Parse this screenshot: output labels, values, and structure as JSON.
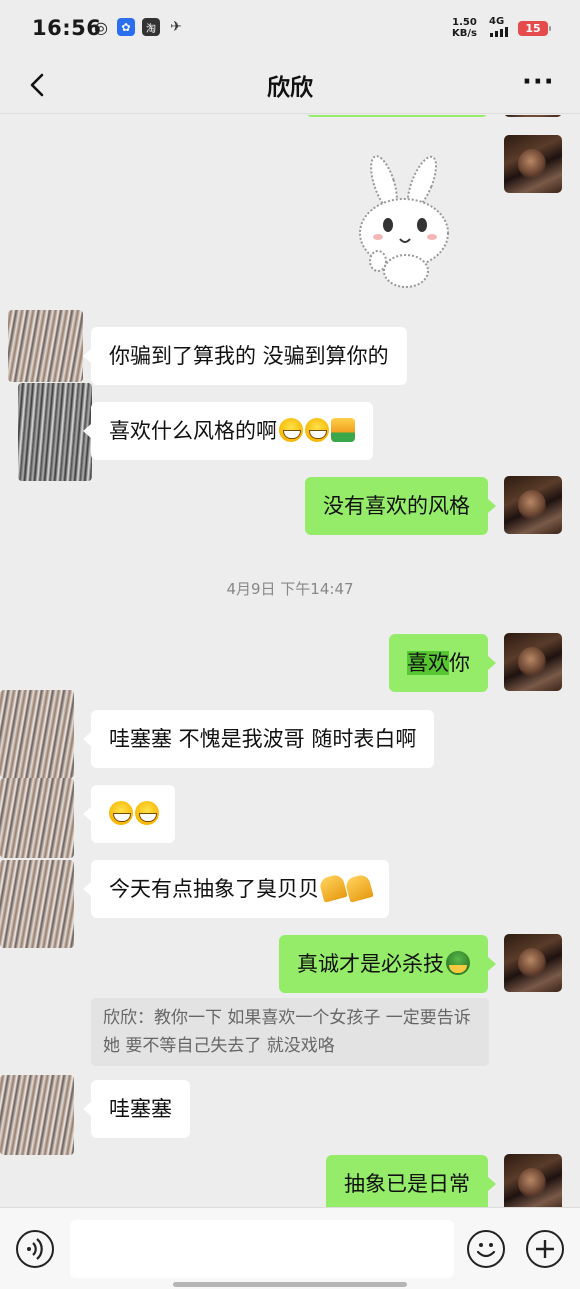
{
  "status_bar": {
    "time": "16:56",
    "net_speed_value": "1.50",
    "net_speed_unit": "KB/s",
    "network": "4G",
    "battery": "15",
    "app_icons": [
      "weibo-icon",
      "baidu-icon",
      "taobao-icon",
      "bird-icon"
    ],
    "taobao_label": "淘",
    "battery_color": "#e64b4b"
  },
  "nav": {
    "title": "欣欣",
    "more": "···"
  },
  "colors": {
    "out_bubble": "#95ec69",
    "in_bubble": "#ffffff",
    "background": "#ededed",
    "highlight": "#58c632"
  },
  "messages": {
    "m1": "你骗到了算我的 没骗到算你的",
    "m2": "喜欢什么风格的啊",
    "m3": "没有喜欢的风格",
    "timestamp": "4月9日 下午14:47",
    "m4_highlight": "喜欢",
    "m4_rest": "你",
    "m5": "哇塞塞 不愧是我波哥 随时表白啊",
    "m7": "今天有点抽象了臭贝贝",
    "m8": "真诚才是必杀技",
    "quote": "欣欣：教你一下 如果喜欢一个女孩子 一定要告诉她 要不等自己失去了 就没戏咯",
    "m9": "哇塞塞",
    "m10": "抽象已是日常"
  },
  "emojis": {
    "m2": [
      "grin-emoji",
      "grin-emoji",
      "thumbs-up-emoji"
    ],
    "m6": [
      "grin-emoji",
      "grin-emoji"
    ],
    "m7": [
      "clap-emoji",
      "clap-emoji"
    ],
    "m8": [
      "turtle-emoji"
    ]
  },
  "sticker": "rabbit-sticker",
  "input_bar": {
    "icons": [
      "voice-icon",
      "emoji-icon",
      "plus-icon"
    ],
    "input_value": ""
  }
}
